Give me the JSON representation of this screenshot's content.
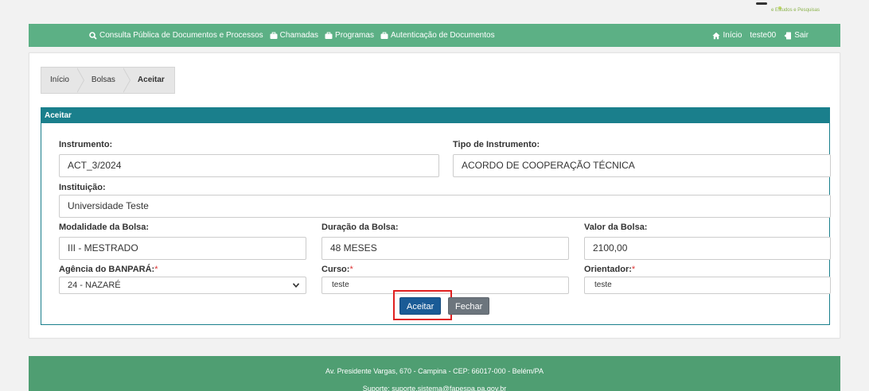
{
  "header": {
    "logo_text": "e Estudos e Pesquisas"
  },
  "nav": {
    "left": [
      {
        "label": "Consulta Pública de Documentos e Processos",
        "icon": "search-icon"
      },
      {
        "label": "Chamadas",
        "icon": "briefcase-icon"
      },
      {
        "label": "Programas",
        "icon": "briefcase-icon"
      },
      {
        "label": "Autenticação de Documentos",
        "icon": "briefcase-icon"
      }
    ],
    "right": [
      {
        "label": "Início",
        "icon": "home-icon"
      },
      {
        "label": "teste00",
        "icon": ""
      },
      {
        "label": "Sair",
        "icon": "logout-icon"
      }
    ]
  },
  "breadcrumb": [
    "Início",
    "Bolsas",
    "Aceitar"
  ],
  "panel": {
    "title": "Aceitar"
  },
  "form": {
    "instrumento": {
      "label": "Instrumento:",
      "value": "ACT_3/2024"
    },
    "tipo_instrumento": {
      "label": "Tipo de Instrumento:",
      "value": "ACORDO DE COOPERAÇÃO TÉCNICA"
    },
    "instituicao": {
      "label": "Instituição:",
      "value": "Universidade Teste"
    },
    "modalidade": {
      "label": "Modalidade da Bolsa:",
      "value": "III - MESTRADO"
    },
    "duracao": {
      "label": "Duração da Bolsa:",
      "value": "48 MESES"
    },
    "valor": {
      "label": "Valor da Bolsa:",
      "value": "2100,00"
    },
    "agencia": {
      "label": "Agência do BANPARÁ:",
      "required": "*",
      "value": "24 - NAZARÉ"
    },
    "curso": {
      "label": "Curso:",
      "required": "*",
      "value": "teste"
    },
    "orientador": {
      "label": "Orientador:",
      "required": "*",
      "value": "teste"
    }
  },
  "buttons": {
    "accept": "Aceitar",
    "close": "Fechar"
  },
  "footer": {
    "address": "Av. Presidente Vargas, 670 - Campina - CEP: 66017-000 - Belém/PA",
    "support": "Suporte: suporte.sistema@fapespa.pa.gov.br"
  },
  "colors": {
    "nav_bg": "#5cb085",
    "panel_header": "#1a7f8c",
    "primary_button": "#1a5b96",
    "secondary_button": "#6c757d",
    "footer_bg": "#4f9e72",
    "highlight": "#e02020"
  }
}
